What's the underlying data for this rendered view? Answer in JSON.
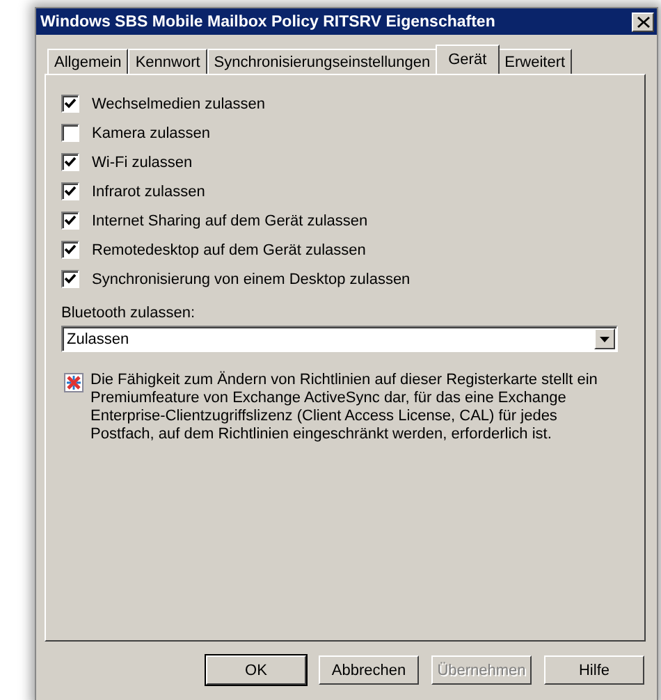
{
  "window": {
    "title": "Windows SBS Mobile Mailbox Policy RITSRV Eigenschaften"
  },
  "tabs": [
    {
      "label": "Allgemein",
      "selected": false
    },
    {
      "label": "Kennwort",
      "selected": false
    },
    {
      "label": "Synchronisierungseinstellungen",
      "selected": false
    },
    {
      "label": "Gerät",
      "selected": true
    },
    {
      "label": "Erweitert",
      "selected": false
    }
  ],
  "options": [
    {
      "label": "Wechselmedien zulassen",
      "checked": true
    },
    {
      "label": "Kamera zulassen",
      "checked": false
    },
    {
      "label": "Wi-Fi zulassen",
      "checked": true
    },
    {
      "label": "Infrarot zulassen",
      "checked": true
    },
    {
      "label": "Internet Sharing auf dem Gerät zulassen",
      "checked": true
    },
    {
      "label": "Remotedesktop auf dem Gerät zulassen",
      "checked": true
    },
    {
      "label": "Synchronisierung von einem Desktop zulassen",
      "checked": true
    }
  ],
  "bluetooth": {
    "label": "Bluetooth zulassen:",
    "value": "Zulassen"
  },
  "notice": "Die Fähigkeit zum Ändern von Richtlinien auf dieser Registerkarte stellt ein Premiumfeature von Exchange ActiveSync dar, für das eine Exchange Enterprise-Clientzugriffslizenz (Client Access License, CAL) für jedes Postfach, auf dem Richtlinien eingeschränkt werden, erforderlich ist.",
  "buttons": [
    {
      "label": "OK",
      "disabled": false,
      "default": true
    },
    {
      "label": "Abbrechen",
      "disabled": false,
      "default": false
    },
    {
      "label": "Übernehmen",
      "disabled": true,
      "default": false
    },
    {
      "label": "Hilfe",
      "disabled": false,
      "default": false
    }
  ]
}
